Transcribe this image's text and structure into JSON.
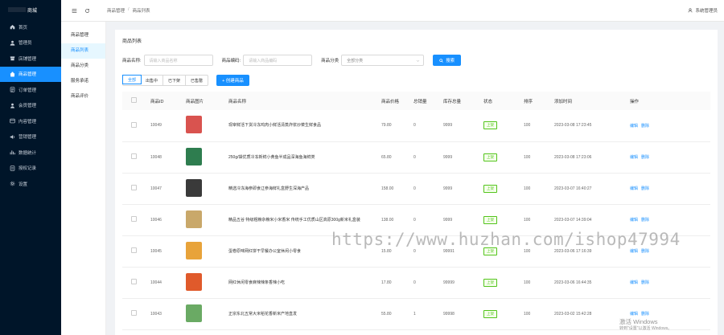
{
  "sidebar": {
    "brand": "商城",
    "items": [
      {
        "label": "首页",
        "icon": "home-icon"
      },
      {
        "label": "管理员",
        "icon": "user-icon"
      },
      {
        "label": "店铺管理",
        "icon": "store-icon"
      },
      {
        "label": "商品管理",
        "icon": "bag-icon",
        "active": true
      },
      {
        "label": "订单管理",
        "icon": "order-icon"
      },
      {
        "label": "会员管理",
        "icon": "member-icon"
      },
      {
        "label": "内容管理",
        "icon": "content-icon"
      },
      {
        "label": "营销管理",
        "icon": "marketing-icon"
      },
      {
        "label": "数据统计",
        "icon": "chart-icon"
      },
      {
        "label": "授权记录",
        "icon": "record-icon"
      },
      {
        "label": "设置",
        "icon": "gear-icon"
      }
    ]
  },
  "topbar": {
    "breadcrumb": [
      "商品管理",
      "商品列表"
    ],
    "separator": "/",
    "admin_label": "系统管理员"
  },
  "submenu": {
    "items": [
      "商品管理",
      "商品列表",
      "商品分类",
      "服务承诺",
      "商品评价"
    ],
    "active_index": 1
  },
  "main": {
    "title": "商品列表",
    "filters": {
      "name_label": "商品名称:",
      "name_placeholder": "请输入商品名称",
      "code_label": "商品编码:",
      "code_placeholder": "请输入商品编码",
      "category_label": "商品分类",
      "category_value": "全部分类",
      "search_button": "搜索"
    },
    "segments": [
      "全部",
      "出售中",
      "已下架",
      "已售罄"
    ],
    "active_segment": 0,
    "create_button": "+ 创建商品",
    "columns": [
      "商品ID",
      "商品图片",
      "商品名称",
      "商品价格",
      "总销量",
      "库存总量",
      "状态",
      "排序",
      "添加时间",
      "操作"
    ],
    "rows": [
      {
        "id": "10049",
        "name": "现宰鲜活下货冷冻鸡肉小鲜活清蒸炸浆炒菜生鲜食品",
        "price": "79.80",
        "sales": "0",
        "stock": "9999",
        "status": "上架",
        "sort": "100",
        "time": "2023-03-08 17:23:45",
        "thumb": "#d9534f"
      },
      {
        "id": "10048",
        "name": "250g/袋优质冷冻新鲜小黄鱼半成品深海鱼海鲜类",
        "price": "65.80",
        "sales": "0",
        "stock": "9999",
        "status": "上架",
        "sort": "100",
        "time": "2023-03-08 17:23:06",
        "thumb": "#2e7d4f"
      },
      {
        "id": "10047",
        "name": "精选冷冻海参即食辽参海鲜礼盒野生深海产品",
        "price": "158.00",
        "sales": "0",
        "stock": "9999",
        "status": "上架",
        "sort": "100",
        "time": "2023-03-07 16:40:27",
        "thumb": "#3a3a3a"
      },
      {
        "id": "10046",
        "name": "精品五谷 特级粗粮杂粮米小米香米 传统手工优质山区高原300g新米礼盒装",
        "price": "138.00",
        "sales": "0",
        "stock": "9999",
        "status": "上架",
        "sort": "100",
        "time": "2023-03-07 14:39:04",
        "thumb": "#c9a86a"
      },
      {
        "id": "10045",
        "name": "蛋卷原味网红饼干早餐办公室休闲小零食",
        "price": "15.80",
        "sales": "0",
        "stock": "99991",
        "status": "上架",
        "sort": "100",
        "time": "2023-03-06 17:16:39",
        "thumb": "#e8a33a"
      },
      {
        "id": "10044",
        "name": "网红休闲零食麻辣辣条香辣小吃",
        "price": "17.80",
        "sales": "0",
        "stock": "99999",
        "status": "上架",
        "sort": "100",
        "time": "2023-03-06 16:44:35",
        "thumb": "#e05a2b"
      },
      {
        "id": "10043",
        "name": "正宗东北五常大米稻花香新米产地直发",
        "price": "55.80",
        "sales": "1",
        "stock": "99998",
        "status": "上架",
        "sort": "100",
        "time": "2023-03-02 15:42:28",
        "thumb": "#6aaa64"
      }
    ],
    "edit_label": "编辑",
    "delete_label": "删除"
  },
  "watermark": "https://www.huzhan.com/ishop47994",
  "activation": {
    "line1": "激活 Windows",
    "line2": "转到\"设置\"以激活 Windows。"
  },
  "colors": {
    "sidebar_bg": "#001529",
    "accent": "#1890ff",
    "status_green": "#52c41a"
  }
}
